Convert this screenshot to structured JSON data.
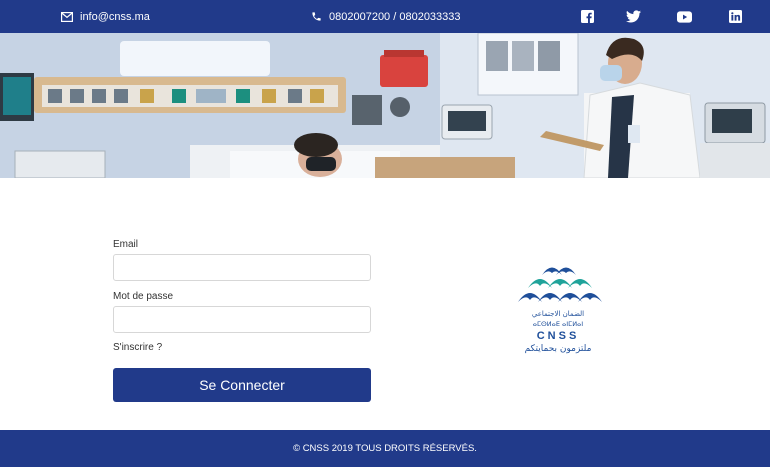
{
  "topbar": {
    "email": "info@cnss.ma",
    "phone": "0802007200 / 0802033333",
    "icons": [
      "envelope-icon",
      "phone-icon",
      "facebook-icon",
      "twitter-icon",
      "youtube-icon",
      "linkedin-icon"
    ]
  },
  "hero": {
    "image": "hospital-scene-photo"
  },
  "form": {
    "email_label": "Email",
    "email_value": "",
    "email_placeholder": "",
    "password_label": "Mot de passe",
    "password_value": "",
    "password_placeholder": "",
    "signup_link": "S'inscrire ?",
    "submit_label": "Se Connecter"
  },
  "logo": {
    "arabic_line1": "الضمان الاجتماعي",
    "tifinagh_line": "ⴰⵎⵙⵍⴰⴹ ⴰⵏⵎⵍⴰⵏ",
    "acronym": "CNSS",
    "tagline": "ملتزمون بحمايتكم"
  },
  "footer": {
    "copyright": "© CNSS 2019 TOUS DROITS RÉSERVÉS."
  },
  "colors": {
    "primary": "#213a8a",
    "logo_blue": "#1f4f9a",
    "logo_teal": "#1fa39a"
  }
}
